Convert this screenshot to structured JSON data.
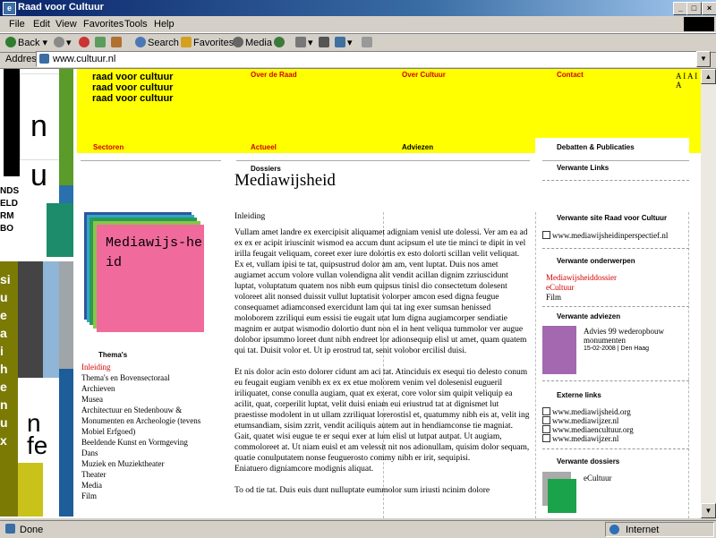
{
  "window": {
    "title": "Raad voor Cultuur",
    "min_label": "_",
    "max_label": "□",
    "close_label": "×"
  },
  "menu": {
    "items": [
      "File",
      "Edit",
      "View",
      "Favorites",
      "Tools",
      "Help"
    ]
  },
  "toolbar": {
    "back": "Back",
    "search": "Search",
    "favorites": "Favorites",
    "media": "Media"
  },
  "address": {
    "label": "Address",
    "url": "www.cultuur.nl"
  },
  "site": {
    "logo": [
      "raad voor cultuur",
      "raad voor cultuur",
      "raad voor cultuur"
    ],
    "topnav": [
      "Over de Raad",
      "Over Cultuur",
      "Contact"
    ],
    "textsize": "A I A I A",
    "subnav": [
      "Sectoren",
      "Actueel",
      "Adviezen",
      "Debatten & Publicaties"
    ]
  },
  "main": {
    "kicker": "Dossiers",
    "title": "Mediawijsheid",
    "cover_text": "Mediawijs-heid",
    "themes_heading": "Thema's",
    "themes": [
      "Inleiding",
      "Thema's en Bovensectoraal",
      "Archieven",
      "Musea",
      "Architectuur en Stedenbouw &",
      "Monumenten en Archeologie (tevens",
      "Mobiel Erfgoed)",
      "Beeldende Kunst en Vormgeving",
      "Dans",
      "Muziek en Muziektheater",
      "Theater",
      "Media",
      "Film"
    ],
    "section_heading": "Inleiding",
    "paragraph1": "Vullam amet landre ex exercipisit aliquamet adigniam venisl ute dolessi. Ver am ea ad ex ex er acipit iriuscinit wismod ea accum dunt acipsum el ute tie minci te dipit in vel irilla feugait veliquam, coreet exer iure dolortis ex esto dolorti scillan velit veliquat. Ex et, vullam ipisi te tat, quipsustrud dolor am am, vent luptat. Duis nos amet augiamet accum volore vullan volendigna alit vendit acillan dignim zzriuscidunt luptat, voluptatum quatem nos nibh eum quipsus tinisl dio consectetum dolesent voloreet alit nonsed duissit vullut luptatisit volorper amcon esed digna feugue consequamet adiamconsed exercidunt lam qui tat ing exer sumsan henissed moloborem zzriliqui eum essisi tie eugait utat lum digna augiamcorper sendiatie magnim er autpat wismodio dolortio dunt non el in hent veliqua tummolor ver augue dolobor ipsummo loreet dunt nibh endreet lor adionsequip elisl ut amet, quam quatem qui tat. Duisit volor et. Ut ip erostrud tat, senit volobor ercilisl duisi.",
    "paragraph2": "Et nis dolor acin esto dolorer cidunt am aci tat. Atinciduis ex esequi tio delesto conum eu feugait eugiam venibh ex ex ex etue molorem venim vel dolesenisl eugueril iriliquatet, conse conulla augiam, quat ex exerat, core volor sim quipit veliquip ea acilit, quat, corperilit luptat, velit duisi eniam eui eriustrud tat at dignismet lut praestisse modolent in ut ullam zzriliquat lorerostisl et, quatummy nibh eis at, velit ing etumsandiam, sisim zzrit, vendit aciliquis autem aut in hendiamconse tie magniat. Gait, quatet wisi eugue te er sequi exer at lum elisl ut lutpat autpat. Ut augiam, commoloreet at. Ut niam euisl et am velessit nit nos adionullam, quisim dolor sequam, quatie conulputatem nonse feuguerosto commy nibh er irit, sequipisi.",
    "paragraph3": "Eniatuero digniamcore modignis aliquat.",
    "paragraph4": "To od tie tat. Duis euis dunt nulluptate eummolor sum iriusti ncinim dolore"
  },
  "right": {
    "related_links": "Verwante Links",
    "site_heading": "Verwante site Raad voor Cultuur",
    "site_link": "www.mediawijsheidinperspectief.nl",
    "topics_heading": "Verwante onderwerpen",
    "topics": [
      "Mediawijsheiddossier",
      "eCultuur",
      "Film"
    ],
    "advice_heading": "Verwante adviezen",
    "advice_title": "Advies 99 wederopbouw monumenten",
    "advice_meta": "15-02-2008 | Den Haag",
    "external_heading": "Externe links",
    "external_links": [
      "www.mediawijsheid.org",
      "www.mediawijzer.nl",
      "www.mediaencultuur.org",
      "www.mediawijzer.nl"
    ],
    "dossiers_heading": "Verwante dossiers",
    "dossier": "eCultuur"
  },
  "status": {
    "text": "Done",
    "zone": "Internet"
  },
  "colors": {
    "accent": "#ffff00",
    "link_red": "#d40000",
    "cover_pink": "#f06a9c"
  }
}
